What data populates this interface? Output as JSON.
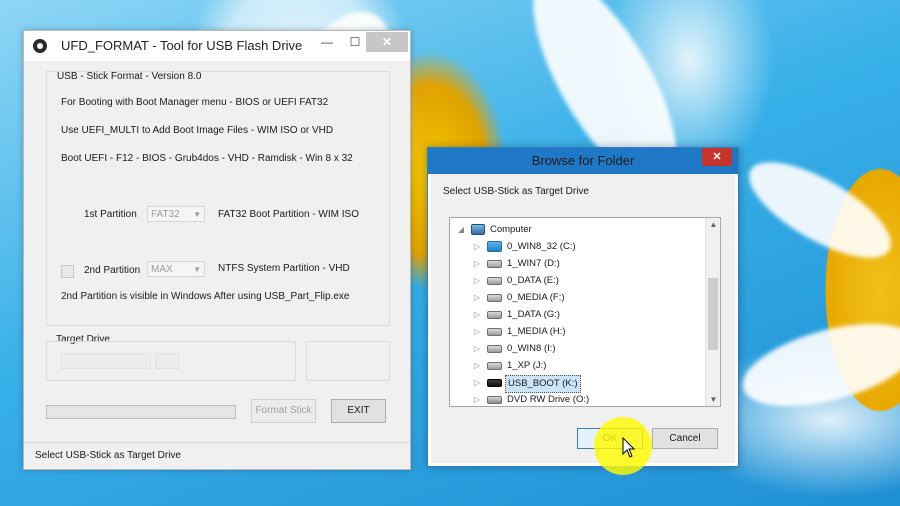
{
  "main_window": {
    "title": "UFD_FORMAT - Tool for USB Flash Drive",
    "caption_buttons": {
      "minimize": "—",
      "maximize": "☐",
      "close": "✕"
    },
    "group_title": "USB - Stick  Format - Version 8.0",
    "info_lines": [
      "For Booting with Boot Manager menu -  BIOS  or  UEFI  FAT32",
      "Use  UEFI_MULTI  to Add Boot Image Files - WIM  ISO or VHD",
      "Boot UEFI - F12 - BIOS - Grub4dos - VHD - Ramdisk - Win 8 x 32"
    ],
    "partition1": {
      "label": "1st Partition",
      "value": "FAT32",
      "desc": "FAT32   Boot   Partition - WIM  ISO"
    },
    "partition2": {
      "label": "2nd Partition",
      "value": "MAX",
      "desc": "NTFS  System  Partition - VHD",
      "checked": false
    },
    "note": "2nd Partition  is visible in Windows After using USB_Part_Flip.exe",
    "target_drive_label": "Target Drive",
    "target_drive_value": "",
    "progress": 0,
    "format_button": "Format Stick",
    "exit_button": "EXIT",
    "status": "Select USB-Stick as Target Drive"
  },
  "browse_dialog": {
    "title": "Browse for Folder",
    "close": "✕",
    "description": "Select USB-Stick as Target Drive",
    "tree": {
      "root": "Computer",
      "items": [
        {
          "label": "0_WIN8_32 (C:)",
          "icon": "windows-drive-icon"
        },
        {
          "label": "1_WIN7 (D:)",
          "icon": "drive-icon"
        },
        {
          "label": "0_DATA (E:)",
          "icon": "drive-icon"
        },
        {
          "label": "0_MEDIA (F:)",
          "icon": "drive-icon"
        },
        {
          "label": "1_DATA (G:)",
          "icon": "drive-icon"
        },
        {
          "label": "1_MEDIA (H:)",
          "icon": "drive-icon"
        },
        {
          "label": "0_WIN8 (I:)",
          "icon": "drive-icon"
        },
        {
          "label": "1_XP (J:)",
          "icon": "drive-icon"
        },
        {
          "label": "USB_BOOT (K:)",
          "icon": "usb-drive-icon",
          "selected": true
        },
        {
          "label": "DVD RW Drive (O:)",
          "icon": "dvd-drive-icon"
        }
      ]
    },
    "ok_button": "OK",
    "cancel_button": "Cancel"
  },
  "colors": {
    "dialog_title_bar": "#1f78c6",
    "close_red": "#c7342b",
    "selection": "#cce4f7",
    "cursor_highlight": "#fffa00"
  }
}
